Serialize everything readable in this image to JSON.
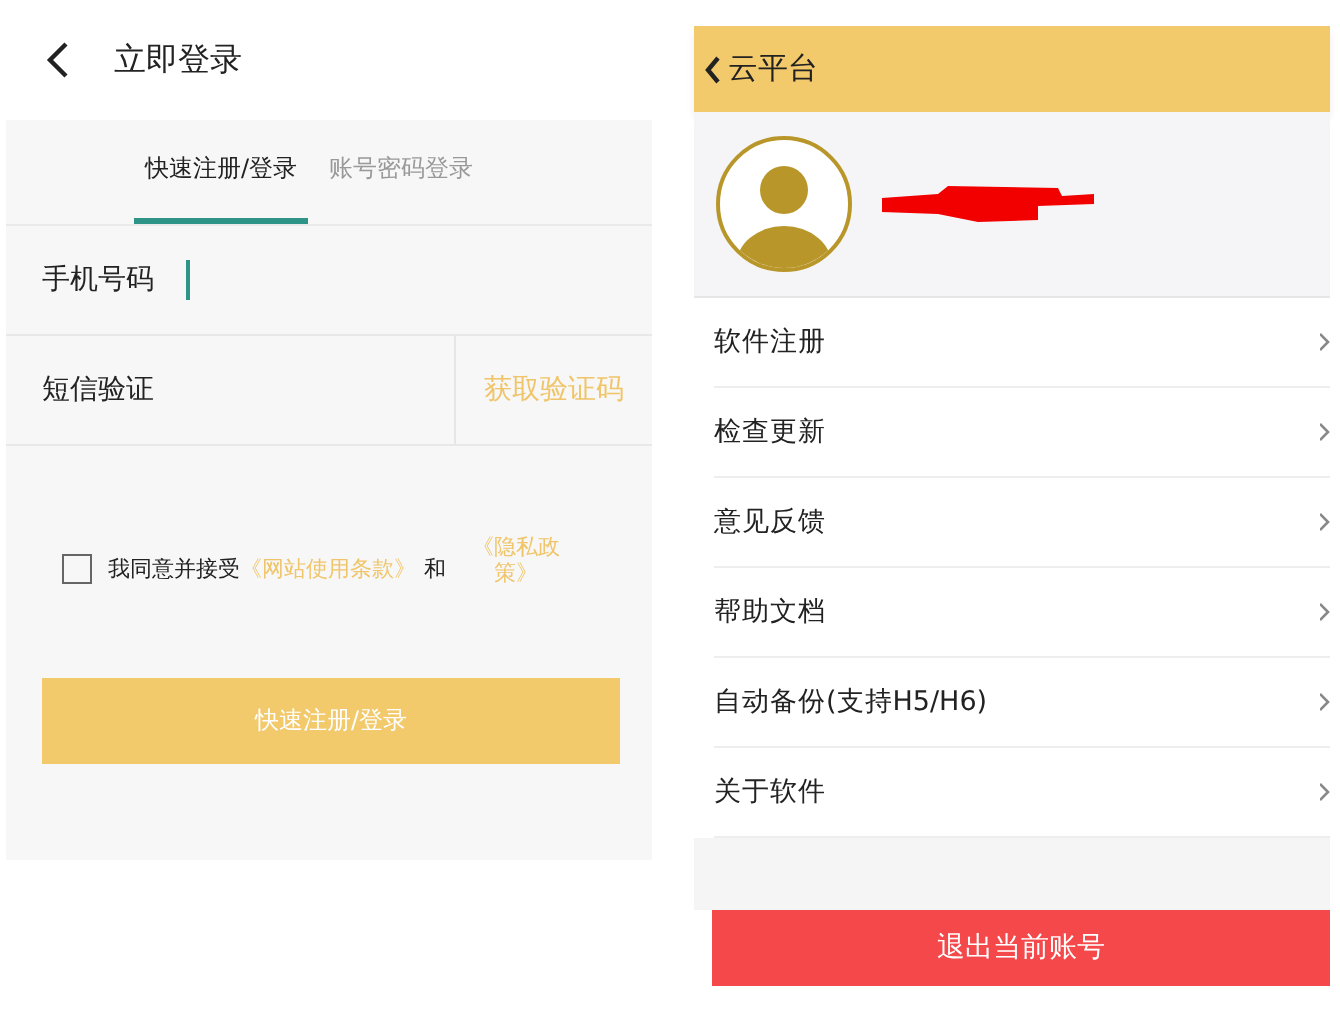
{
  "login": {
    "title": "立即登录",
    "tabs": [
      {
        "label": "快速注册/登录",
        "selected": true
      },
      {
        "label": "账号密码登录",
        "selected": false
      }
    ],
    "phone_label": "手机号码",
    "sms_label": "短信验证",
    "get_code": "获取验证码",
    "agreement": {
      "checked": false,
      "text": "我同意并接受",
      "terms_link": "《网站使用条款》",
      "and": "和",
      "privacy_link": "《隐私政策》"
    },
    "submit": "快速注册/登录"
  },
  "cloud": {
    "title": "云平台",
    "menu": [
      {
        "label": "软件注册"
      },
      {
        "label": "检查更新"
      },
      {
        "label": "意见反馈"
      },
      {
        "label": "帮助文档"
      },
      {
        "label": "自动备份(支持H5/H6)"
      },
      {
        "label": "关于软件"
      }
    ],
    "logout": "退出当前账号"
  }
}
